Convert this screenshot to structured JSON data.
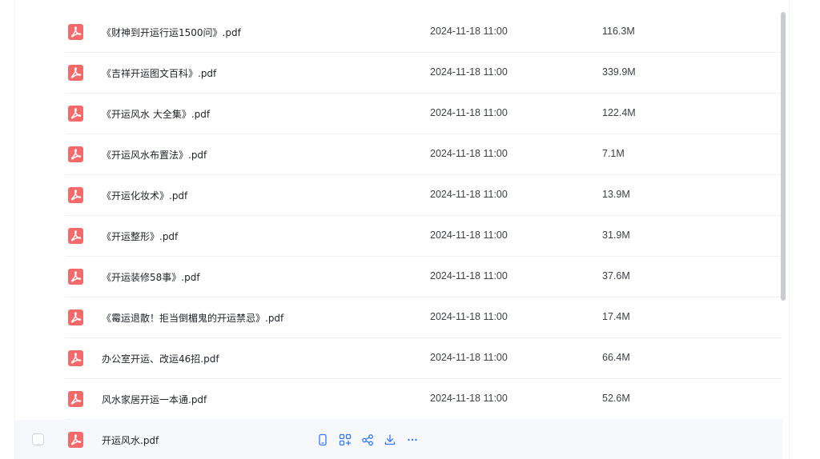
{
  "files": [
    {
      "name": "《财神到开运行运1500问》.pdf",
      "date": "2024-11-18 11:00",
      "size": "116.3M"
    },
    {
      "name": "《吉祥开运图文百科》.pdf",
      "date": "2024-11-18 11:00",
      "size": "339.9M"
    },
    {
      "name": "《开运风水 大全集》.pdf",
      "date": "2024-11-18 11:00",
      "size": "122.4M"
    },
    {
      "name": "《开运风水布置法》.pdf",
      "date": "2024-11-18 11:00",
      "size": "7.1M"
    },
    {
      "name": "《开运化妆术》.pdf",
      "date": "2024-11-18 11:00",
      "size": "13.9M"
    },
    {
      "name": "《开运整形》.pdf",
      "date": "2024-11-18 11:00",
      "size": "31.9M"
    },
    {
      "name": "《开运装修58事》.pdf",
      "date": "2024-11-18 11:00",
      "size": "37.6M"
    },
    {
      "name": "《霉运退散！拒当倒楣鬼的开运禁忌》.pdf",
      "date": "2024-11-18 11:00",
      "size": "17.4M"
    },
    {
      "name": "办公室开运、改运46招.pdf",
      "date": "2024-11-18 11:00",
      "size": "66.4M"
    },
    {
      "name": "风水家居开运一本通.pdf",
      "date": "2024-11-18 11:00",
      "size": "52.6M"
    },
    {
      "name": "开运风水.pdf",
      "date": "",
      "size": ""
    }
  ],
  "hovered_row_actions": [
    "phone-icon",
    "save-to-drive-icon",
    "share-icon",
    "download-icon",
    "more-icon"
  ],
  "colors": {
    "pdf_icon": "#f46a6a",
    "action_icon": "#3377ff",
    "hover_row_bg": "#f6f8fb",
    "scrollbar": "#c9cbd0"
  }
}
